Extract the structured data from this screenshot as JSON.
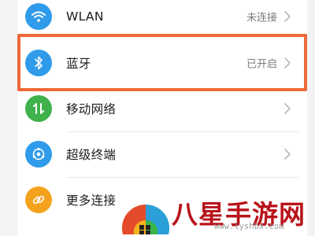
{
  "settings": {
    "items": [
      {
        "label": "WLAN",
        "status": "未连接",
        "icon": "wifi-icon",
        "color": "#2f9bea"
      },
      {
        "label": "蓝牙",
        "status": "已开启",
        "icon": "bluetooth-icon",
        "color": "#2f9bea"
      },
      {
        "label": "移动网络",
        "status": "",
        "icon": "mobile-network-icon",
        "color": "#3fb24b"
      },
      {
        "label": "超级终端",
        "status": "",
        "icon": "super-device-icon",
        "color": "#2f9bea"
      },
      {
        "label": "更多连接",
        "status": "",
        "icon": "link-icon",
        "color": "#f4a21d"
      }
    ]
  },
  "highlight": {
    "color": "#ee6a3a",
    "target": "蓝牙"
  },
  "watermark": {
    "text": "八星手游网",
    "url": "www.lyshbx.com",
    "color": "#b9141a"
  }
}
